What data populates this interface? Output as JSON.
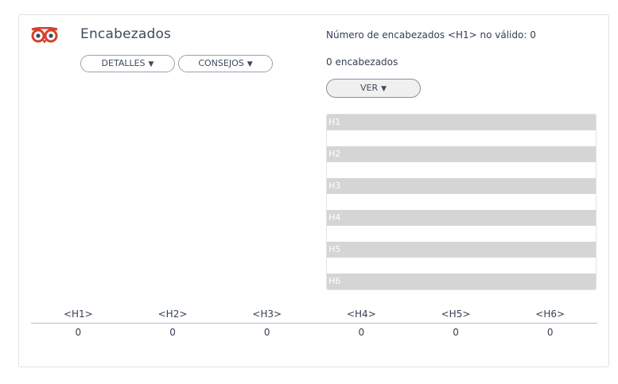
{
  "section": {
    "title": "Encabezados",
    "details_label": "DETALLES",
    "tips_label": "CONSEJOS",
    "view_label": "VER",
    "chevron": "❯"
  },
  "summary": {
    "invalid_h1_text": "Número de encabezados <H1> no válido: 0",
    "count_text": "0 encabezados"
  },
  "outline": {
    "rows": [
      "H1",
      "H2",
      "H3",
      "H4",
      "H5",
      "H6"
    ]
  },
  "stats": {
    "headers": [
      "<H1>",
      "<H2>",
      "<H3>",
      "<H4>",
      "<H5>",
      "<H6>"
    ],
    "values": [
      "0",
      "0",
      "0",
      "0",
      "0",
      "0"
    ]
  },
  "colors": {
    "owl_red": "#d6402b",
    "bar_gray": "#d5d5d5"
  }
}
